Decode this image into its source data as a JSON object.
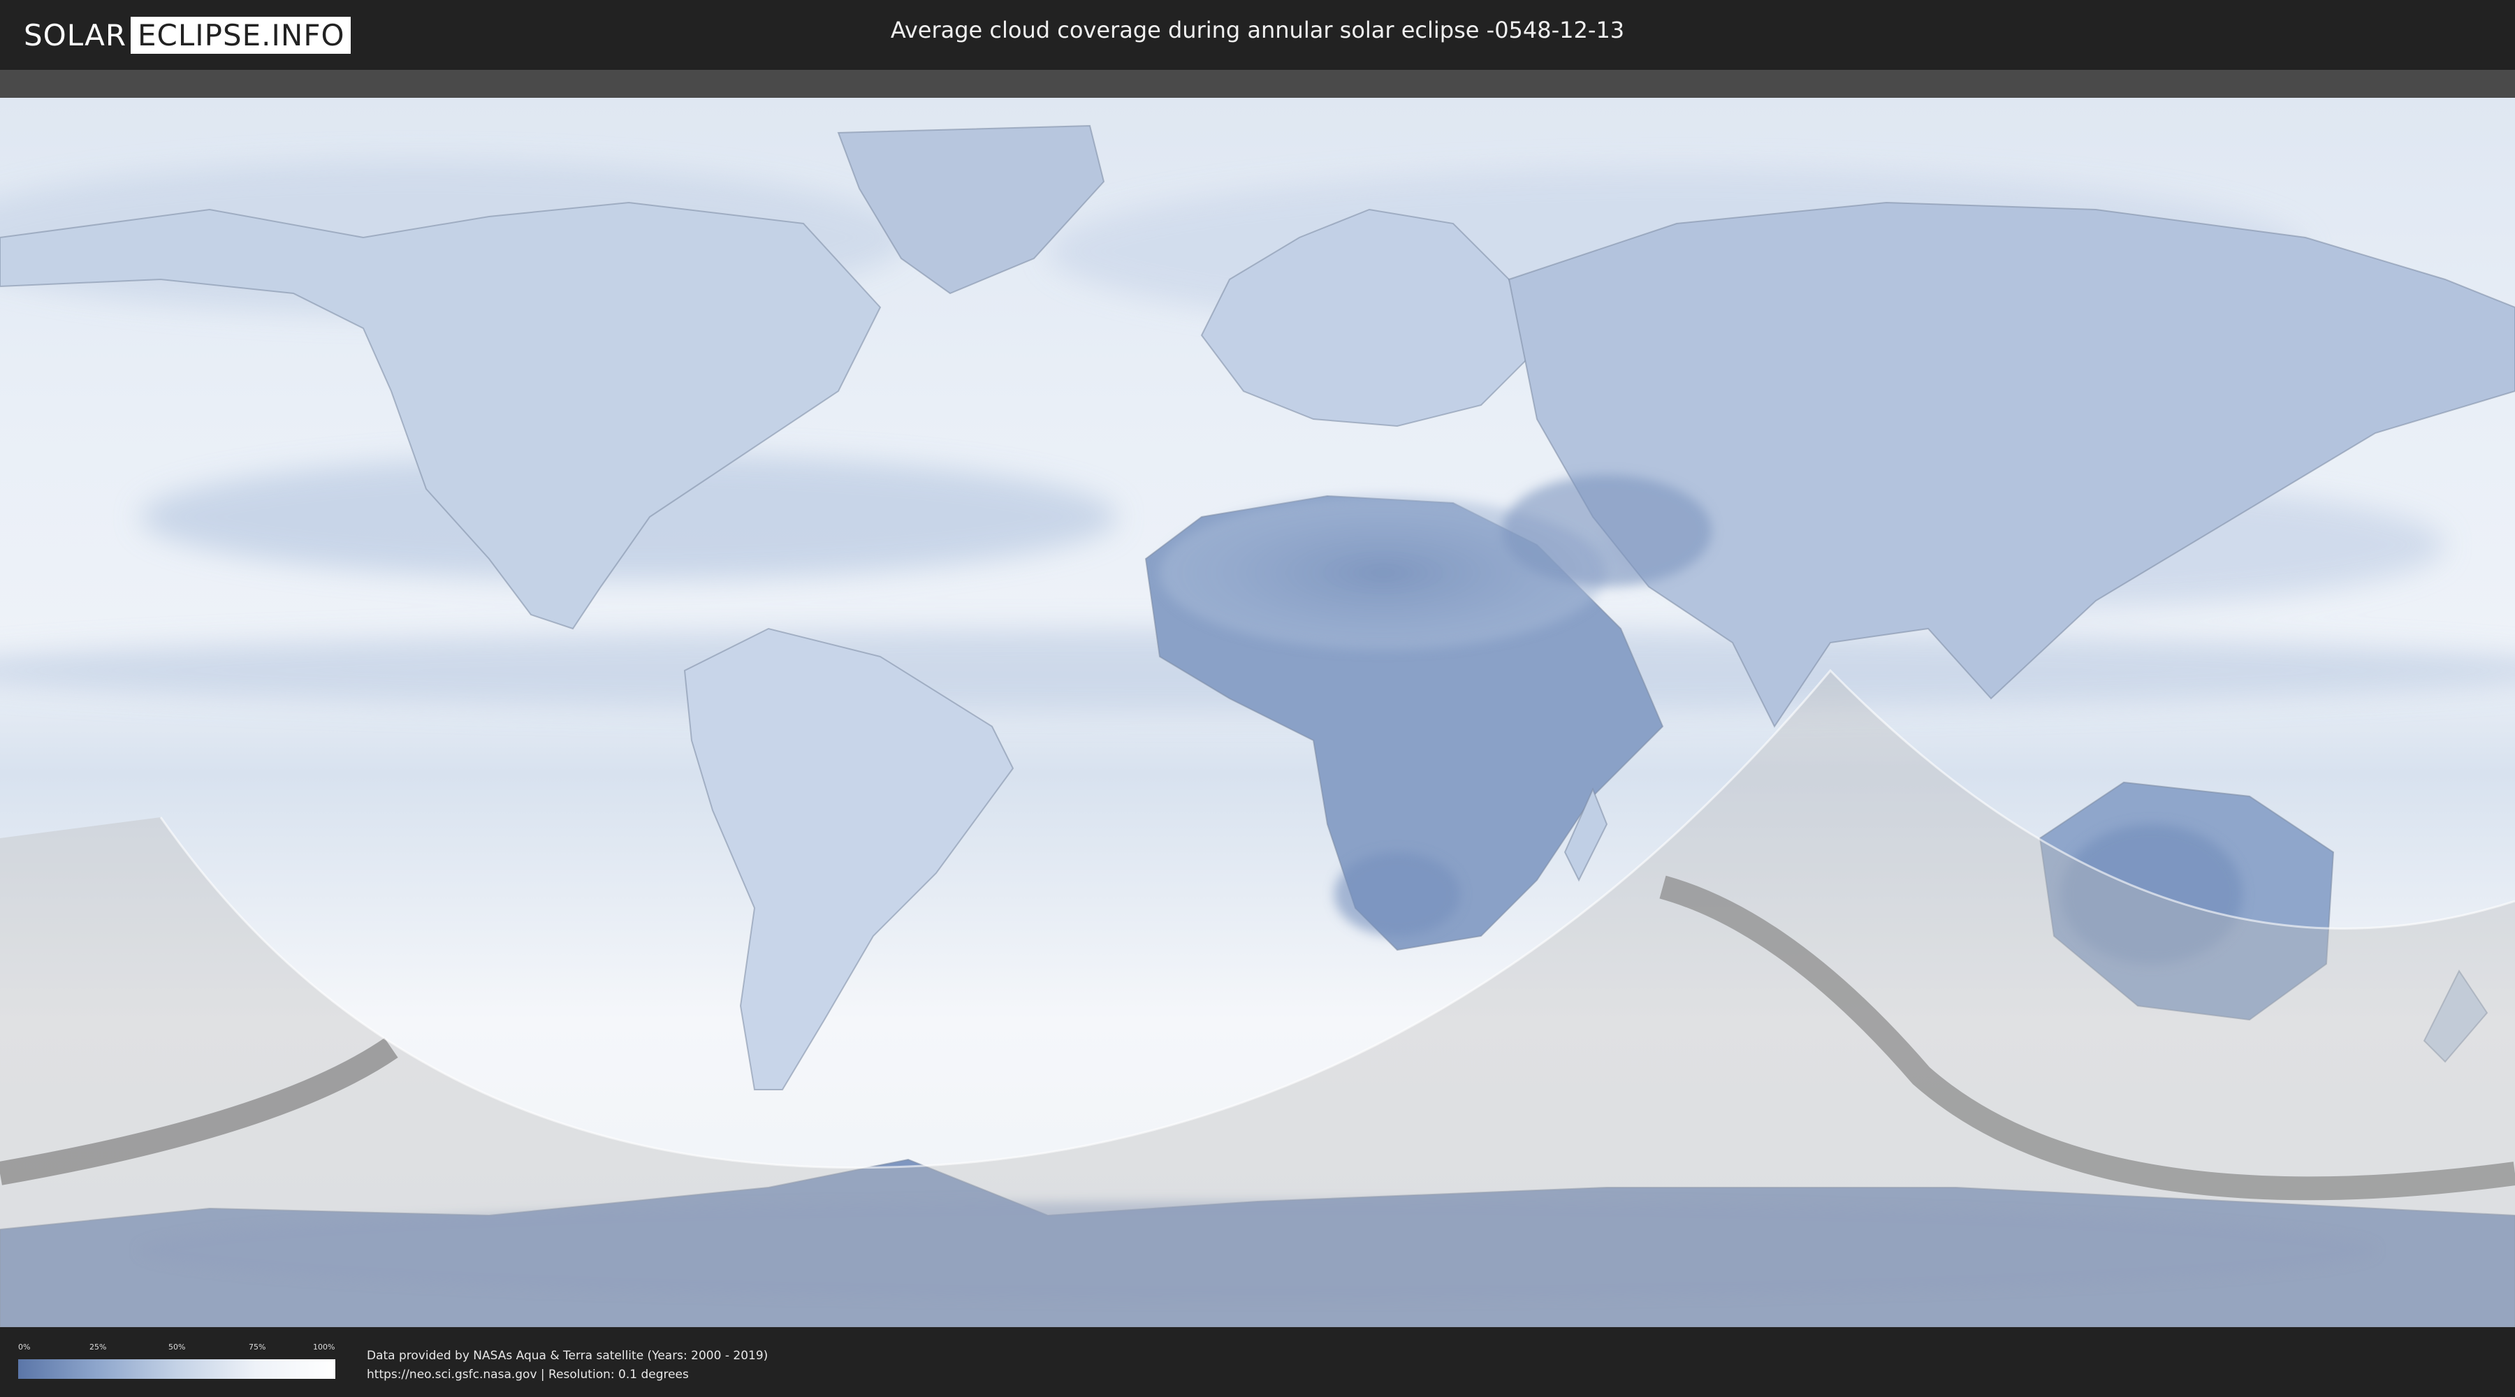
{
  "header": {
    "logo_left": "SOLAR",
    "logo_right": "ECLIPSE.INFO",
    "title": "Average cloud coverage during annular solar eclipse -0548-12-13"
  },
  "legend": {
    "ticks": [
      "0%",
      "25%",
      "50%",
      "75%",
      "100%"
    ],
    "gradient_colors": [
      "#5b76a8",
      "#8ea6cc",
      "#c4d2e6",
      "#eef2f8",
      "#ffffff"
    ]
  },
  "credits": {
    "line1": "Data provided by NASAs Aqua & Terra satellite (Years: 2000 - 2019)",
    "line2": "https://neo.sci.gsfc.nasa.gov | Resolution: 0.1 degrees"
  },
  "colors": {
    "header_bg": "#222222",
    "cloud_light": "#f2f5fa",
    "cloud_dark": "#6d88b6",
    "path_gray": "#9a9a9a"
  }
}
